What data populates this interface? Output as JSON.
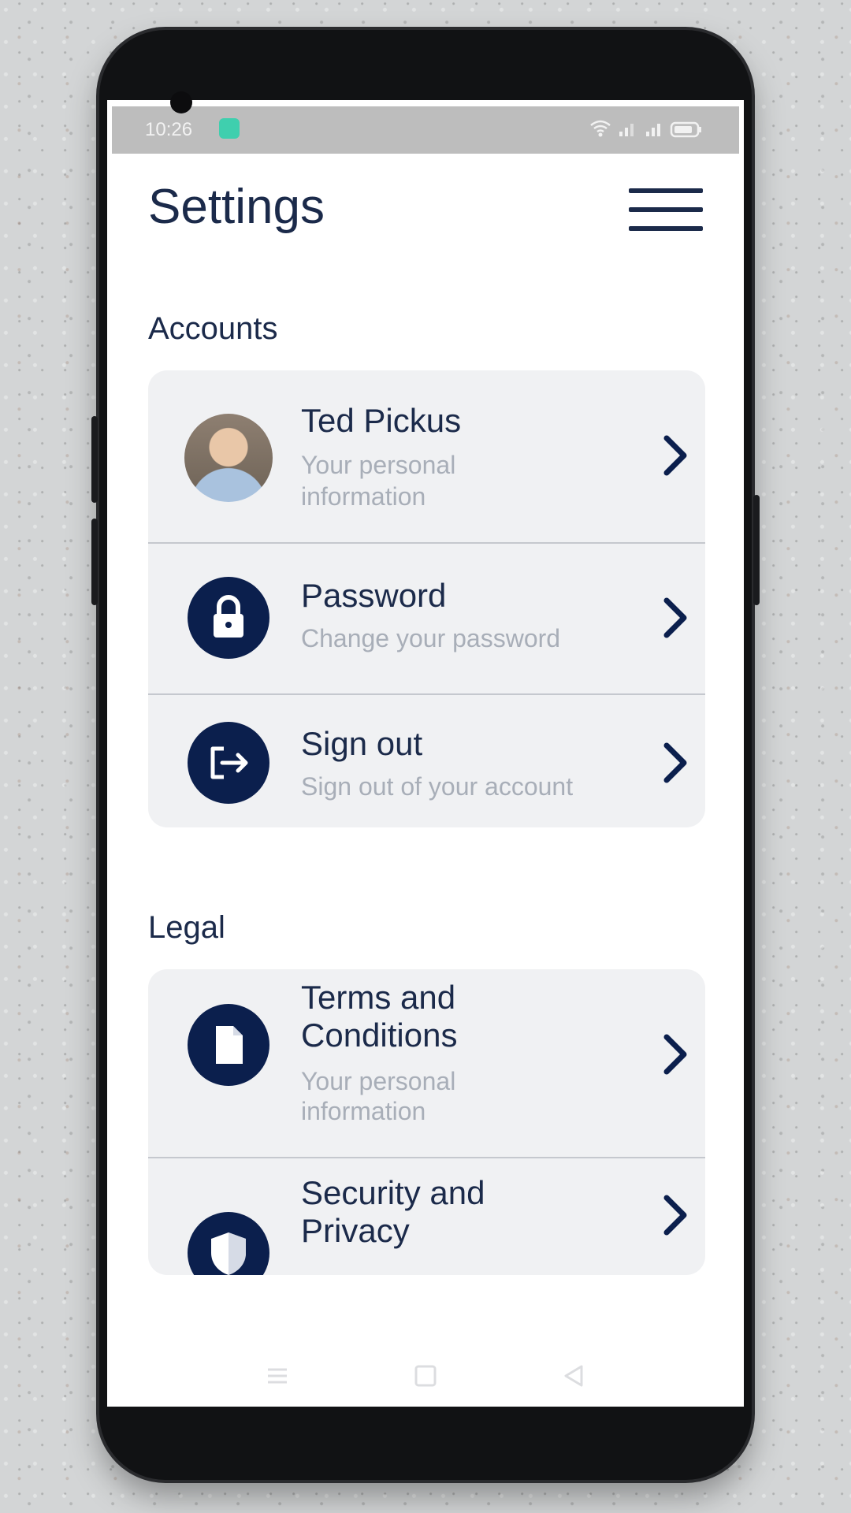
{
  "status_bar": {
    "time": "10:26",
    "app_icon": "green-app-notification-icon",
    "system_icons": [
      "wifi-icon",
      "signal-icon",
      "signal-icon",
      "battery-icon"
    ]
  },
  "header": {
    "title": "Settings",
    "menu_icon": "hamburger-menu-icon"
  },
  "sections": {
    "accounts": {
      "title": "Accounts",
      "items": [
        {
          "title": "Ted Pickus",
          "subtitle_line1": "Your personal",
          "subtitle_line2": "information",
          "icon": "user-avatar"
        },
        {
          "title": "Password",
          "subtitle": "Change your password",
          "icon": "lock-icon"
        },
        {
          "title": "Sign out",
          "subtitle": "Sign out of your account",
          "icon": "sign-out-icon"
        }
      ]
    },
    "legal": {
      "title": "Legal",
      "items": [
        {
          "title_line1": "Terms and",
          "title_line2": "Conditions",
          "subtitle_line1": "Your personal",
          "subtitle_line2": "information",
          "icon": "document-icon"
        },
        {
          "title_line1": "Security and",
          "title_line2": "Privacy",
          "icon": "shield-icon"
        }
      ]
    }
  },
  "nav_bar": {
    "items": [
      "recents-icon",
      "home-icon",
      "back-icon"
    ]
  },
  "colors": {
    "accent": "#0b1f4d",
    "text_primary": "#1b2a4a",
    "text_secondary": "#a8aeb8",
    "card_bg": "#f0f1f3"
  }
}
